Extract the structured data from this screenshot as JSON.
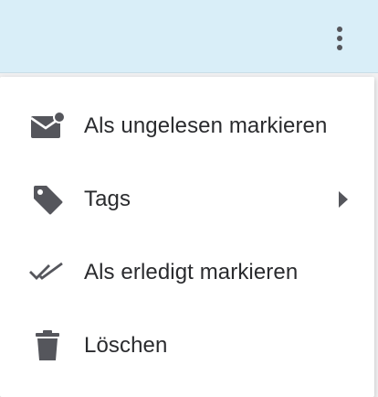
{
  "header": {
    "more_icon": "vertical-dots-icon"
  },
  "menu": {
    "items": [
      {
        "label": "Als ungelesen markieren",
        "icon": "mail-unread-icon"
      },
      {
        "label": "Tags",
        "icon": "tag-icon",
        "submenu_icon": "triangle-right-icon"
      },
      {
        "label": "Als erledigt markieren",
        "icon": "double-check-icon"
      },
      {
        "label": "Löschen",
        "icon": "trash-icon"
      }
    ]
  },
  "colors": {
    "header_bg": "#d9eef8",
    "icon": "#55565c",
    "text": "#2a2b2e",
    "menu_bg": "#ffffff"
  }
}
